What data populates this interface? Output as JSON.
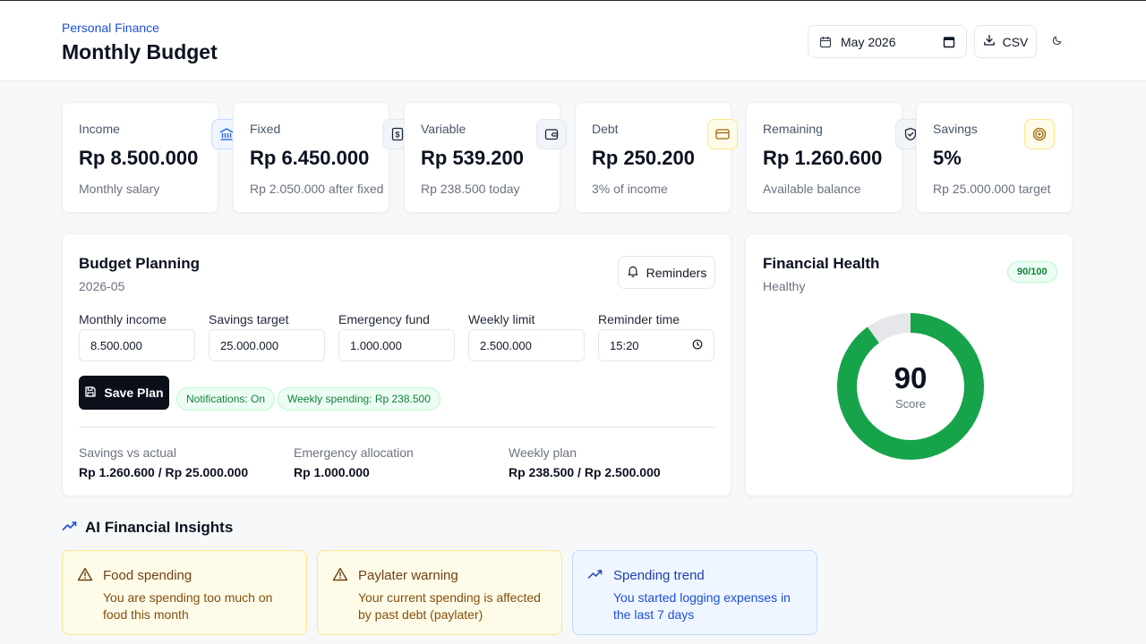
{
  "header": {
    "eyebrow": "Personal Finance",
    "title": "Monthly Budget",
    "month_value": "May 2026",
    "csv_label": "CSV"
  },
  "stats": [
    {
      "label": "Income",
      "value": "Rp 8.500.000",
      "sub": "Monthly salary",
      "icon": "bank-icon"
    },
    {
      "label": "Fixed",
      "value": "Rp 6.450.000",
      "sub": "Rp 2.050.000 after fixed",
      "icon": "receipt-icon"
    },
    {
      "label": "Variable",
      "value": "Rp 539.200",
      "sub": "Rp 238.500 today",
      "icon": "wallet-icon"
    },
    {
      "label": "Debt",
      "value": "Rp 250.200",
      "sub": "3% of income",
      "icon": "credit-card-icon"
    },
    {
      "label": "Remaining",
      "value": "Rp 1.260.600",
      "sub": "Available balance",
      "icon": "shield-icon"
    },
    {
      "label": "Savings",
      "value": "5%",
      "sub": "Rp 25.000.000 target",
      "icon": "target-icon"
    }
  ],
  "planning": {
    "title": "Budget Planning",
    "subtitle": "2026-05",
    "reminders_label": "Reminders",
    "fields": [
      {
        "label": "Monthly income",
        "value": "8.500.000"
      },
      {
        "label": "Savings target",
        "value": "25.000.000"
      },
      {
        "label": "Emergency fund",
        "value": "1.000.000"
      },
      {
        "label": "Weekly limit",
        "value": "2.500.000"
      },
      {
        "label": "Reminder time",
        "value": "15:20"
      }
    ],
    "save_label": "Save Plan",
    "pills": [
      "Notifications: On",
      "Weekly spending: Rp 238.500"
    ],
    "summary": [
      {
        "label": "Savings vs actual",
        "value": "Rp 1.260.600 / Rp 25.000.000"
      },
      {
        "label": "Emergency allocation",
        "value": "Rp 1.000.000"
      },
      {
        "label": "Weekly plan",
        "value": "Rp 238.500 / Rp 2.500.000"
      }
    ]
  },
  "health": {
    "title": "Financial Health",
    "status": "Healthy",
    "badge": "90/100",
    "score": "90",
    "score_label": "Score",
    "score_value": 90,
    "score_max": 100,
    "ring_color": "#16a34a",
    "track_color": "#e5e7eb"
  },
  "insights": {
    "title": "AI Financial Insights",
    "cards": [
      {
        "title": "Food spending",
        "body": "You are spending too much on food this month",
        "kind": "warning",
        "icon": "warning-icon"
      },
      {
        "title": "Paylater warning",
        "body": "Your current spending is affected by past debt (paylater)",
        "kind": "warning",
        "icon": "warning-icon"
      },
      {
        "title": "Spending trend",
        "body": "You started logging expenses in the last 7 days",
        "kind": "info",
        "icon": "trend-up-icon"
      }
    ]
  }
}
